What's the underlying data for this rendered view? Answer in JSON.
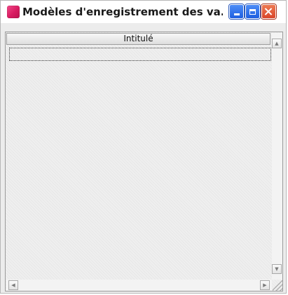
{
  "window": {
    "title": "Modèles d'enregistrement des va...",
    "icon": "app-icon",
    "accent_color": "#d81b60"
  },
  "caption_buttons": {
    "minimize_icon": "minimize-icon",
    "maximize_icon": "maximize-icon",
    "close_icon": "close-icon"
  },
  "list": {
    "columns": [
      {
        "label": "Intitulé"
      }
    ],
    "rows": []
  },
  "scrollbars": {
    "up_glyph": "▲",
    "down_glyph": "▼",
    "left_glyph": "◀",
    "right_glyph": "▶"
  }
}
